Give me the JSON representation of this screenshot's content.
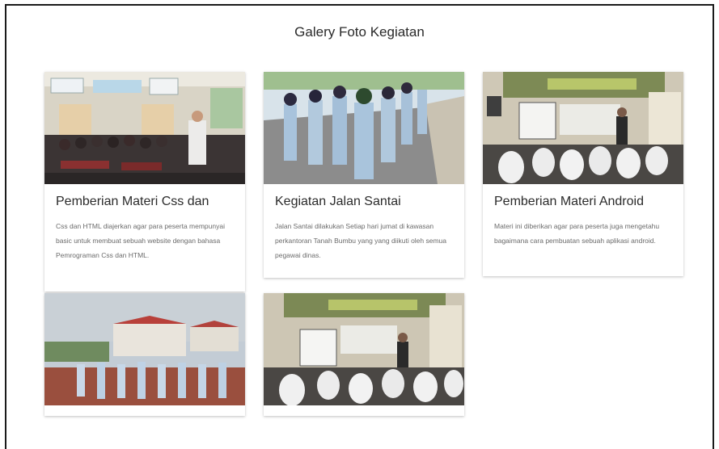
{
  "page": {
    "title": "Galery Foto Kegiatan"
  },
  "cards": [
    {
      "title": "Pemberian Materi Css dan",
      "description": "Css dan HTML diajerkan agar para peserta mempunyai basic untuk membuat sebuah website dengan bahasa Pemrograman Css dan HTML.",
      "photo": "classroom-group-photo"
    },
    {
      "title": "Kegiatan Jalan Santai",
      "description": "Jalan Santai dilakukan Setiap hari jumat di kawasan perkantoran Tanah Bumbu yang yang diikuti oleh semua pegawai dinas.",
      "photo": "students-walking-photo"
    },
    {
      "title": "Pemberian Materi Android",
      "description": "Materi ini diberikan agar para peserta juga mengetahu bagaimana cara pembuatan sebuah aplikasi android.",
      "photo": "android-class-photo"
    },
    {
      "title": "",
      "description": "",
      "photo": "field-assembly-photo"
    },
    {
      "title": "",
      "description": "",
      "photo": "seminar-room-photo"
    }
  ]
}
